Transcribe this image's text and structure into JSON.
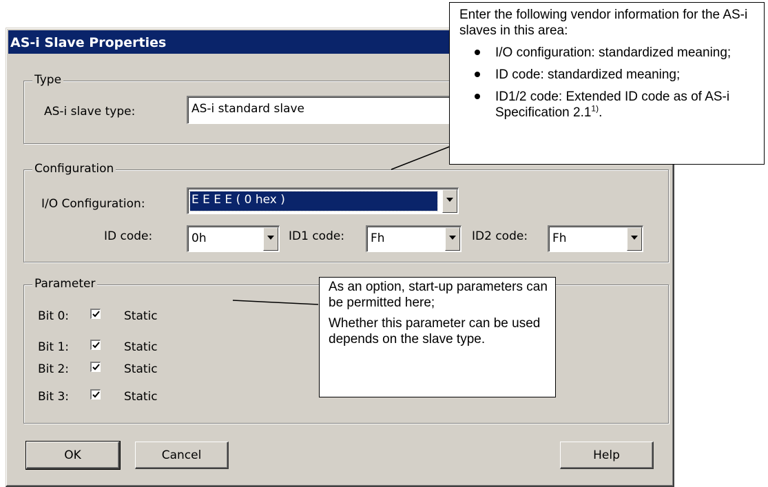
{
  "dialog": {
    "title": "AS-i Slave Properties"
  },
  "type_group": {
    "legend": "Type",
    "slave_type_label": "AS-i slave type:",
    "slave_type_value": "AS-i standard slave"
  },
  "config_group": {
    "legend": "Configuration",
    "io_label": "I/O Configuration:",
    "io_value": "E  E  E  E ( 0 hex )",
    "id_label": "ID code:",
    "id_value": "0h",
    "id1_label": "ID1 code:",
    "id1_value": "Fh",
    "id2_label": "ID2 code:",
    "id2_value": "Fh"
  },
  "param_group": {
    "legend": "Parameter",
    "bits": [
      {
        "label": "Bit 0:",
        "checked": true,
        "text": "Static"
      },
      {
        "label": "Bit 1:",
        "checked": true,
        "text": "Static"
      },
      {
        "label": "Bit 2:",
        "checked": true,
        "text": "Static"
      },
      {
        "label": "Bit 3:",
        "checked": true,
        "text": "Static"
      }
    ]
  },
  "buttons": {
    "ok": "OK",
    "cancel": "Cancel",
    "help": "Help"
  },
  "callout_top": {
    "intro": "Enter the following vendor information for the AS-i slaves in this area:",
    "bullet1": "I/O configuration: standardized meaning;",
    "bullet2": "ID code: standardized meaning;",
    "bullet3": "ID1/2 code: Extended ID code as of AS-i Specification 2.1",
    "bullet3_sup": "1)",
    "bullet3_end": "."
  },
  "callout_mid": {
    "p1": "As an option, start-up parameters can be permitted here;",
    "p2": "Whether this parameter can be used depends on the slave type."
  },
  "colors": {
    "dialog_face": "#d4d0c8",
    "titlebar": "#0a246a",
    "selection": "#0a246a"
  }
}
